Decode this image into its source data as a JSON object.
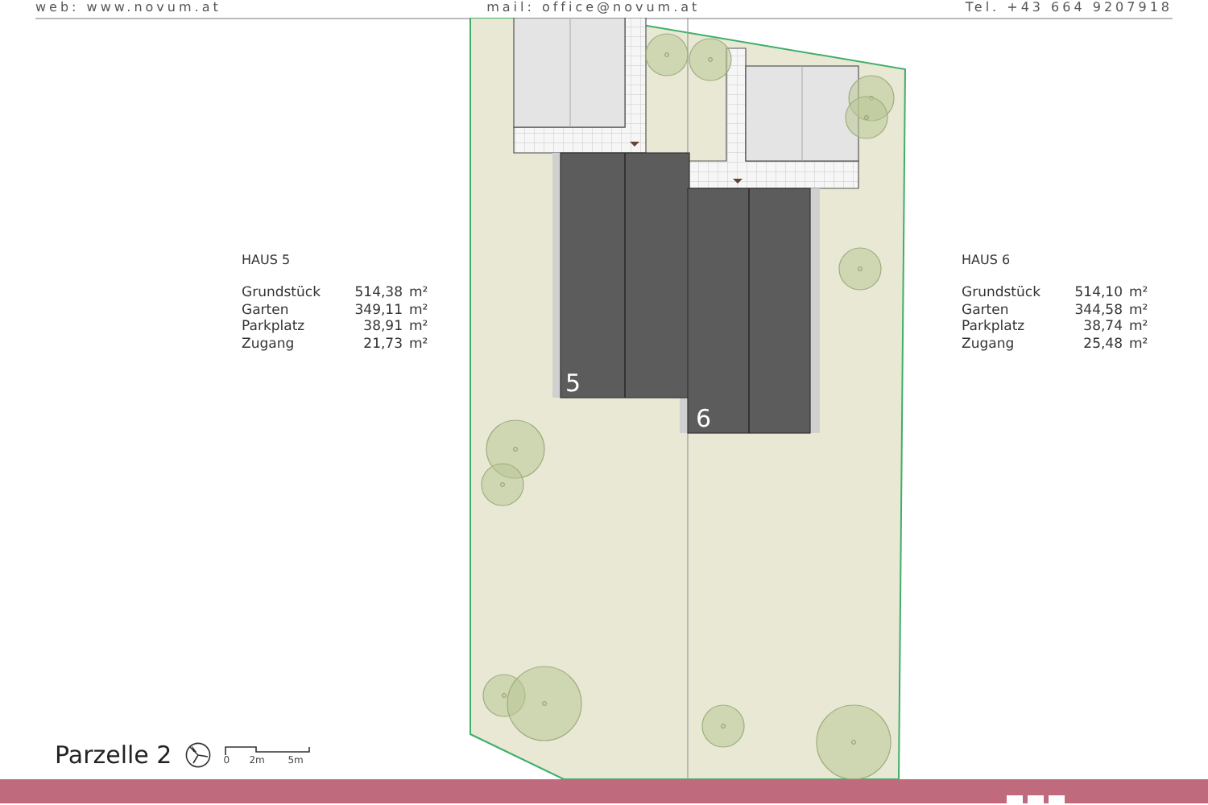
{
  "header": {
    "web": "web: www.novum.at",
    "mail": "mail: office@novum.at",
    "phone": "Tel. +43 664 9207918"
  },
  "houses": [
    {
      "name": "HAUS 5",
      "plan_label": "5",
      "areas": [
        {
          "label": "Grundstück",
          "value": "514,38",
          "unit": "m²"
        },
        {
          "label": "Garten",
          "value": "349,11",
          "unit": "m²"
        },
        {
          "label": "Parkplatz",
          "value": "38,91",
          "unit": "m²"
        },
        {
          "label": "Zugang",
          "value": "21,73",
          "unit": "m²"
        }
      ]
    },
    {
      "name": "HAUS 6",
      "plan_label": "6",
      "areas": [
        {
          "label": "Grundstück",
          "value": "514,10",
          "unit": "m²"
        },
        {
          "label": "Garten",
          "value": "344,58",
          "unit": "m²"
        },
        {
          "label": "Parkplatz",
          "value": "38,74",
          "unit": "m²"
        },
        {
          "label": "Zugang",
          "value": "25,48",
          "unit": "m²"
        }
      ]
    }
  ],
  "title": "Parzelle 2",
  "scale": {
    "labels": [
      "0",
      "2m",
      "5m"
    ]
  }
}
